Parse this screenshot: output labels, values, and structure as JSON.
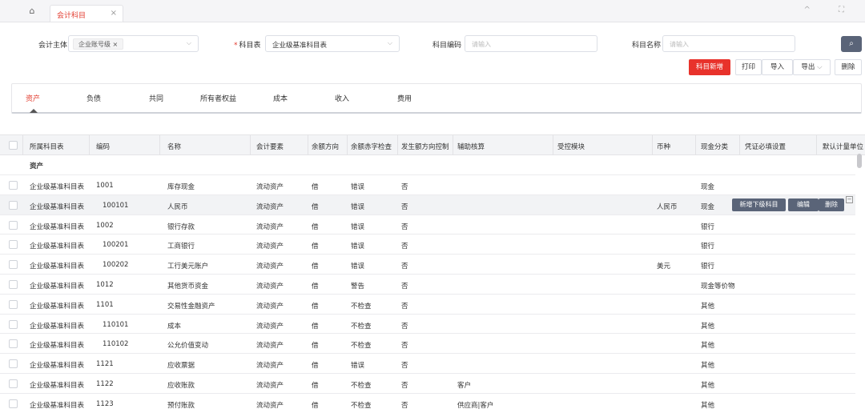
{
  "tabbar": {
    "home_icon": "home-icon",
    "tab_label": "会计科目",
    "close": "×",
    "right_icons": "^ ⛶"
  },
  "filters": {
    "entity_label": "会计主体",
    "entity_tag": "企业账号级 ×",
    "chart_label": "科目表",
    "chart_value": "企业级基准科目表",
    "code_label": "科目编码",
    "code_placeholder": "请输入",
    "name_label": "科目名称",
    "name_placeholder": "请输入"
  },
  "toolbar": {
    "add": "科目新增",
    "print": "打印",
    "import": "导入",
    "export": "导出",
    "delete": "删除"
  },
  "categories": [
    "资产",
    "负债",
    "共同",
    "所有者权益",
    "成本",
    "收入",
    "费用"
  ],
  "columns": [
    "所属科目表",
    "编码",
    "名称",
    "会计要素",
    "余额方向",
    "余额赤字检查",
    "发生额方向控制",
    "辅助核算",
    "受控模块",
    "币种",
    "现金分类",
    "凭证必填设置",
    "默认计量单位"
  ],
  "group_label": "资产",
  "row_actions": {
    "add_child": "新增下级科目",
    "edit": "编辑",
    "delete": "删除"
  },
  "rows": [
    {
      "table": "企业级基准科目表",
      "code": "1001",
      "name": "库存现金",
      "element": "流动资产",
      "dir": "借",
      "check": "错误",
      "ctrl": "否",
      "aux": "",
      "module": "",
      "cur": "",
      "cash": "现金"
    },
    {
      "table": "企业级基准科目表",
      "code": "100101",
      "name": "人民币",
      "element": "流动资产",
      "dir": "借",
      "check": "错误",
      "ctrl": "否",
      "aux": "",
      "module": "",
      "cur": "人民币",
      "cash": "现金"
    },
    {
      "table": "企业级基准科目表",
      "code": "1002",
      "name": "银行存款",
      "element": "流动资产",
      "dir": "借",
      "check": "错误",
      "ctrl": "否",
      "aux": "",
      "module": "",
      "cur": "",
      "cash": "银行"
    },
    {
      "table": "企业级基准科目表",
      "code": "100201",
      "name": "工商银行",
      "element": "流动资产",
      "dir": "借",
      "check": "错误",
      "ctrl": "否",
      "aux": "",
      "module": "",
      "cur": "",
      "cash": "银行"
    },
    {
      "table": "企业级基准科目表",
      "code": "100202",
      "name": "工行美元账户",
      "element": "流动资产",
      "dir": "借",
      "check": "错误",
      "ctrl": "否",
      "aux": "",
      "module": "",
      "cur": "美元",
      "cash": "银行"
    },
    {
      "table": "企业级基准科目表",
      "code": "1012",
      "name": "其他货币资金",
      "element": "流动资产",
      "dir": "借",
      "check": "警告",
      "ctrl": "否",
      "aux": "",
      "module": "",
      "cur": "",
      "cash": "现金等价物"
    },
    {
      "table": "企业级基准科目表",
      "code": "1101",
      "name": "交易性金融资产",
      "element": "流动资产",
      "dir": "借",
      "check": "不检查",
      "ctrl": "否",
      "aux": "",
      "module": "",
      "cur": "",
      "cash": "其他"
    },
    {
      "table": "企业级基准科目表",
      "code": "110101",
      "name": "成本",
      "element": "流动资产",
      "dir": "借",
      "check": "不检查",
      "ctrl": "否",
      "aux": "",
      "module": "",
      "cur": "",
      "cash": "其他"
    },
    {
      "table": "企业级基准科目表",
      "code": "110102",
      "name": "公允价值变动",
      "element": "流动资产",
      "dir": "借",
      "check": "不检查",
      "ctrl": "否",
      "aux": "",
      "module": "",
      "cur": "",
      "cash": "其他"
    },
    {
      "table": "企业级基准科目表",
      "code": "1121",
      "name": "应收票据",
      "element": "流动资产",
      "dir": "借",
      "check": "错误",
      "ctrl": "否",
      "aux": "",
      "module": "",
      "cur": "",
      "cash": "其他"
    },
    {
      "table": "企业级基准科目表",
      "code": "1122",
      "name": "应收账款",
      "element": "流动资产",
      "dir": "借",
      "check": "不检查",
      "ctrl": "否",
      "aux": "客户",
      "module": "",
      "cur": "",
      "cash": "其他"
    },
    {
      "table": "企业级基准科目表",
      "code": "1123",
      "name": "预付账款",
      "element": "流动资产",
      "dir": "借",
      "check": "不检查",
      "ctrl": "否",
      "aux": "供应商|客户",
      "module": "",
      "cur": "",
      "cash": "其他"
    }
  ]
}
